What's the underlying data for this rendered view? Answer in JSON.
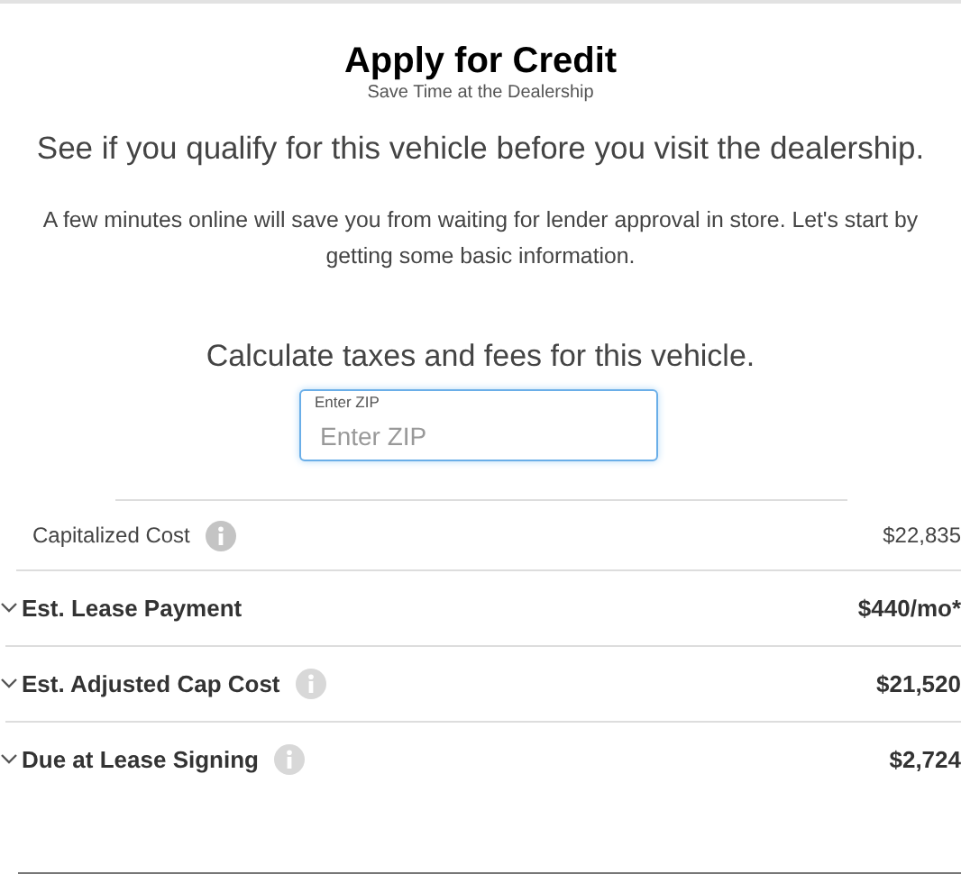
{
  "header": {
    "title": "Apply for Credit",
    "subtitle": "Save Time at the Dealership"
  },
  "tagline": "See if you qualify for this vehicle before you visit the dealership.",
  "intro": "A few minutes online will save you from waiting for lender approval in store. Let's start by getting some basic information.",
  "calculator": {
    "heading": "Calculate taxes and fees for this vehicle.",
    "zip_field": {
      "label": "Enter ZIP",
      "placeholder": "Enter ZIP"
    }
  },
  "rows": [
    {
      "kind": "plain",
      "label": "Capitalized Cost",
      "info": true,
      "value": "$22,835"
    },
    {
      "kind": "expandable",
      "label": "Est. Lease Payment",
      "info": false,
      "value": "$440/mo*",
      "expanded": false
    },
    {
      "kind": "expandable",
      "label": "Est. Adjusted Cap Cost",
      "info": true,
      "value": "$21,520",
      "expanded": false
    },
    {
      "kind": "expandable",
      "label": "Due at Lease Signing",
      "info": true,
      "value": "$2,724",
      "expanded": false
    }
  ]
}
